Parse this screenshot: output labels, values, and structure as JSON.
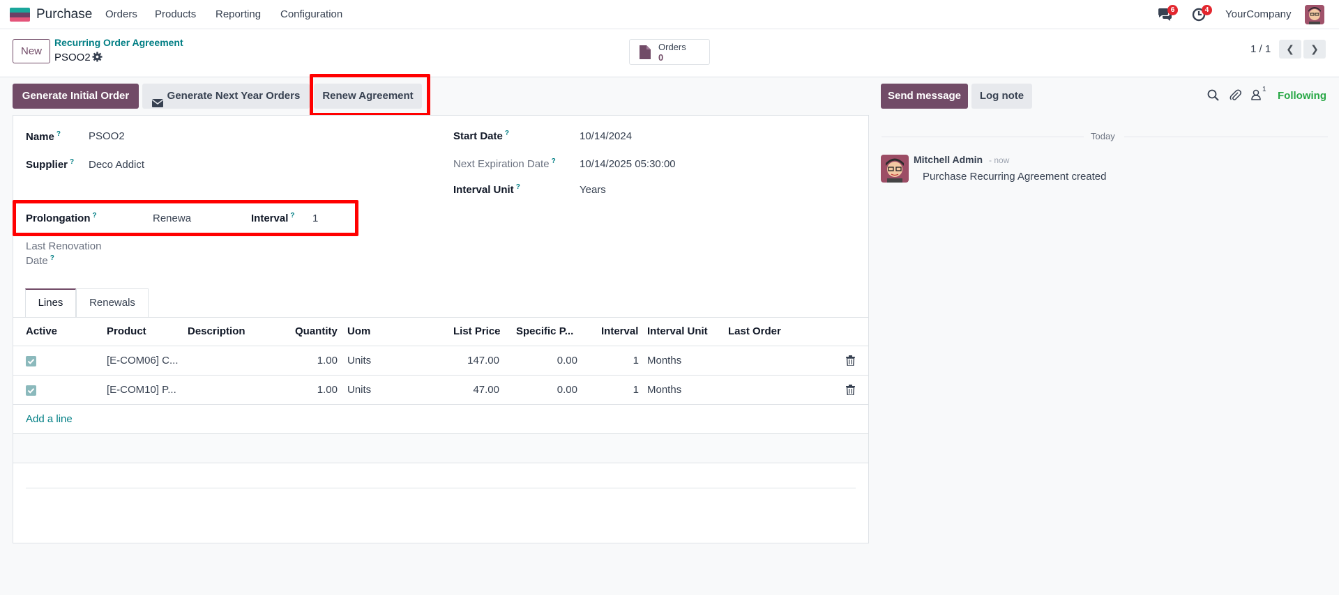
{
  "navbar": {
    "app_name": "Purchase",
    "menu": [
      "Orders",
      "Products",
      "Reporting",
      "Configuration"
    ],
    "messages_count": "6",
    "activities_count": "4",
    "company": "YourCompany"
  },
  "breadcrumb": {
    "new_label": "New",
    "parent": "Recurring Order Agreement",
    "current": "PSOO2"
  },
  "smart_button": {
    "label": "Orders",
    "value": "0"
  },
  "pager": {
    "value": "1 / 1"
  },
  "actions": {
    "generate_initial": "Generate Initial Order",
    "generate_next_year": "Generate Next Year Orders",
    "renew": "Renew Agreement"
  },
  "form": {
    "name_label": "Name",
    "name_value": "PSOO2",
    "supplier_label": "Supplier",
    "supplier_value": "Deco Addict",
    "start_date_label": "Start Date",
    "start_date_value": "10/14/2024",
    "next_exp_label": "Next Expiration Date",
    "next_exp_value": "10/14/2025 05:30:00",
    "interval_unit_label": "Interval Unit",
    "interval_unit_value": "Years",
    "prolongation_label": "Prolongation",
    "prolongation_value": "Renewa",
    "interval_label": "Interval",
    "interval_value": "1",
    "last_renovation_label_1": "Last Renovation",
    "last_renovation_label_2": "Date",
    "help_mark": "?"
  },
  "tabs": [
    "Lines",
    "Renewals"
  ],
  "table": {
    "headers": [
      "Active",
      "Product",
      "Description",
      "Quantity",
      "Uom",
      "List Price",
      "Specific P...",
      "Interval",
      "Interval Unit",
      "Last Order"
    ],
    "rows": [
      {
        "product": "[E-COM06] C...",
        "description": "",
        "quantity": "1.00",
        "uom": "Units",
        "list_price": "147.00",
        "specific_price": "0.00",
        "interval": "1",
        "interval_unit": "Months",
        "last_order": ""
      },
      {
        "product": "[E-COM10] P...",
        "description": "",
        "quantity": "1.00",
        "uom": "Units",
        "list_price": "47.00",
        "specific_price": "0.00",
        "interval": "1",
        "interval_unit": "Months",
        "last_order": ""
      }
    ],
    "add_line": "Add a line"
  },
  "chatter": {
    "send_message": "Send message",
    "log_note": "Log note",
    "followers_count": "1",
    "following": "Following",
    "date_separator": "Today",
    "author": "Mitchell Admin",
    "time": "- now",
    "message": "Purchase Recurring Agreement created"
  },
  "colors": {
    "brand": "#714b67",
    "accent": "#017e84",
    "highlight": "#ff0000",
    "following": "#28a745"
  }
}
